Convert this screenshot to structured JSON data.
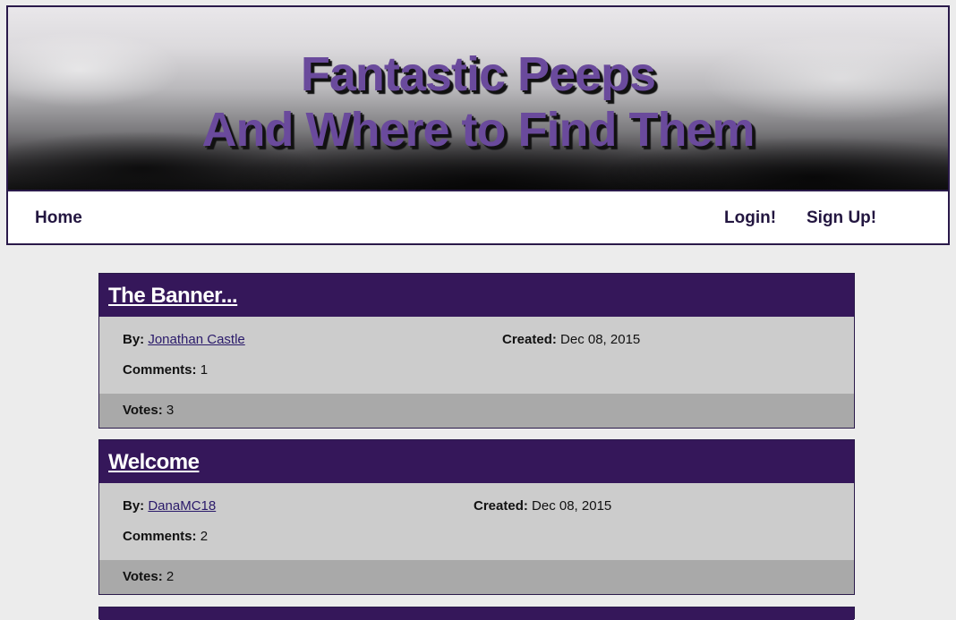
{
  "banner": {
    "title_line1": "Fantastic Peeps",
    "title_line2": "And Where to Find Them"
  },
  "nav": {
    "home": "Home",
    "login": "Login!",
    "signup": "Sign Up!"
  },
  "labels": {
    "by": "By:",
    "created": "Created:",
    "comments": "Comments:",
    "votes": "Votes:"
  },
  "posts": [
    {
      "title": "The Banner...",
      "author": "Jonathan Castle ",
      "created": "Dec 08, 2015",
      "comments": "1",
      "votes": "3"
    },
    {
      "title": "Welcome",
      "author": "DanaMC18 ",
      "created": "Dec 08, 2015",
      "comments": "2",
      "votes": "2"
    },
    {
      "title": ""
    }
  ],
  "colors": {
    "post_header": "#35175a",
    "title_purple": "#6a4a9c",
    "nav_text": "#231640",
    "page_bg": "#ececec"
  }
}
